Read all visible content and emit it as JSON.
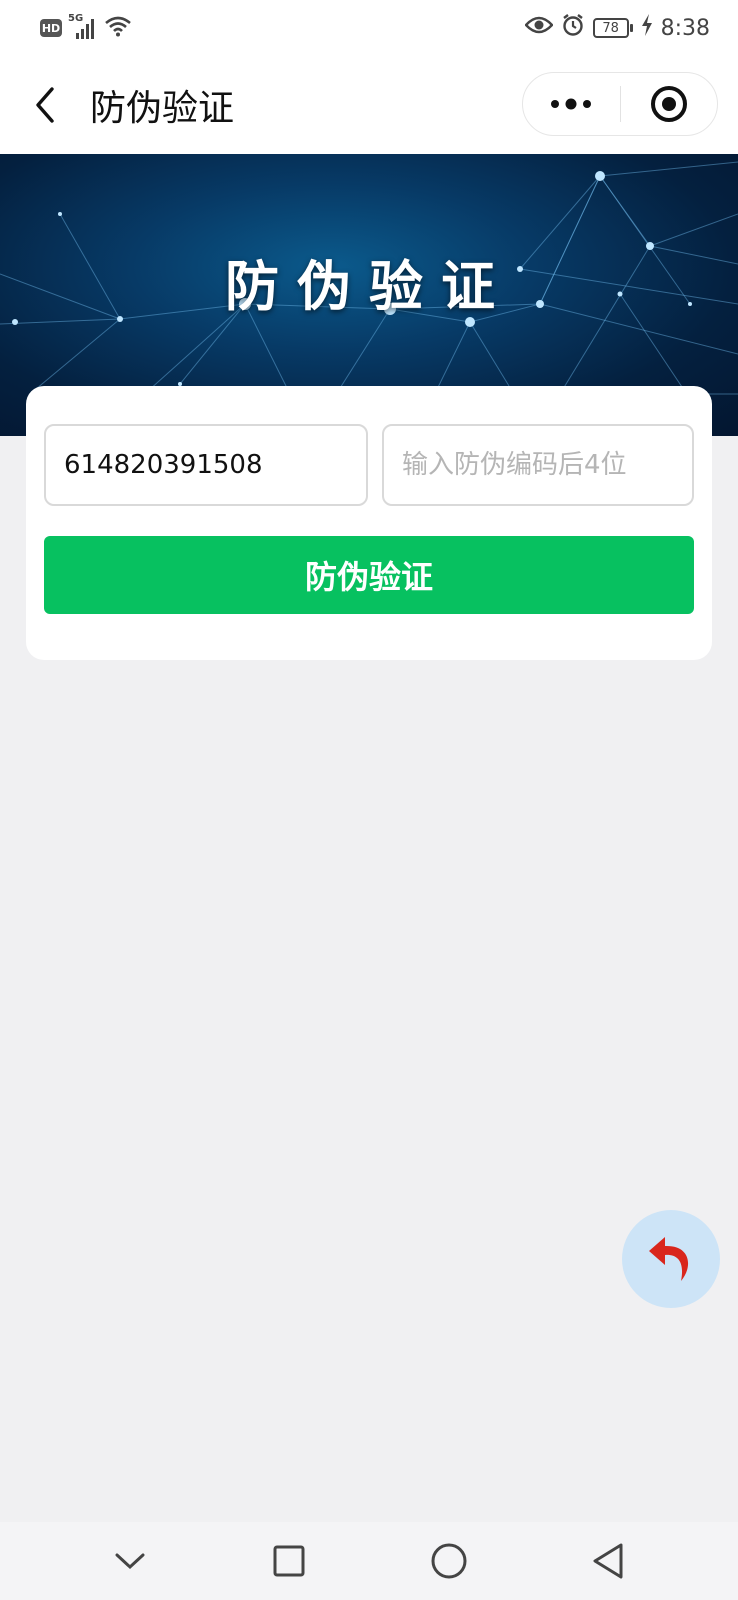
{
  "status_bar": {
    "hd_label": "HD",
    "network_label": "5G",
    "battery_level": "78",
    "time": "8:38"
  },
  "nav": {
    "title": "防伪验证"
  },
  "banner": {
    "title": "防伪验证"
  },
  "form": {
    "code_value": "614820391508",
    "suffix_placeholder": "输入防伪编码后4位",
    "verify_label": "防伪验证"
  },
  "colors": {
    "accent_green": "#07c160",
    "fab_bg": "#cde4f7",
    "fab_icon": "#d9261c",
    "page_bg": "#f0f0f2"
  },
  "icons": {
    "back": "chevron-left-icon",
    "more": "more-dots-icon",
    "close": "target-circle-icon",
    "fab": "undo-arrow-icon",
    "sys_back": "triangle-back-icon",
    "sys_home": "circle-home-icon",
    "sys_recent": "square-recent-icon",
    "sys_down": "chevron-down-icon"
  }
}
